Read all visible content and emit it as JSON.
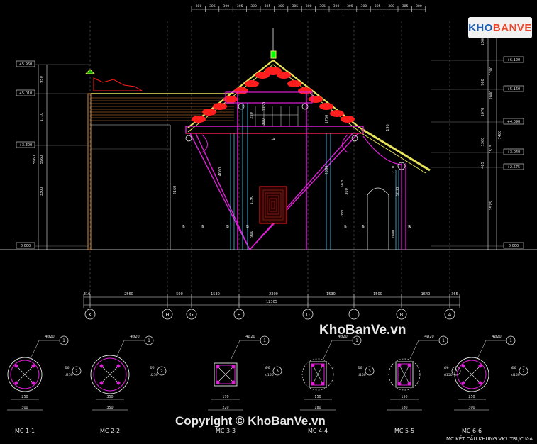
{
  "top_dims": [
    "300",
    "305",
    "300",
    "305",
    "300",
    "305",
    "300",
    "305",
    "300",
    "305",
    "300",
    "305",
    "300",
    "305",
    "300",
    "305",
    "300"
  ],
  "levels_left": [
    "+5.960",
    "+5.010",
    "+3.300",
    "0.000"
  ],
  "levels_right": [
    "+6.120",
    "+5.160",
    "+4.090",
    "+3.040",
    "+2.575",
    "0.000"
  ],
  "right_dims": [
    "1000",
    "1280",
    "960",
    "2080",
    "1070",
    "1360",
    "7400",
    "1515",
    "465",
    "2575"
  ],
  "left_dims": [
    "1710",
    "950",
    "3300",
    "5960",
    "5960"
  ],
  "bottom_dims": [
    "310",
    "2560",
    "500",
    "1530",
    "2300",
    "1530",
    "1500",
    "1640",
    "365"
  ],
  "total_dim": "12305",
  "grid_axes": [
    "K",
    "H",
    "G",
    "E",
    "D",
    "C",
    "B",
    "A"
  ],
  "inner_dims": [
    "250",
    "300",
    "1750",
    "2160",
    "4060",
    "1190",
    "900",
    "2080",
    "2880",
    "1750",
    "300",
    "5820",
    "195",
    "2110",
    "5030",
    "2880"
  ],
  "column_marks": [
    "1",
    "1",
    "2",
    "2",
    "1",
    "1",
    "3"
  ],
  "sections": [
    {
      "label": "MC 1-1",
      "bars": "4Ø20",
      "stirrup": "Ø6",
      "dia": "d250",
      "dim": "250",
      "width": "300",
      "callout": "1",
      "side": "2"
    },
    {
      "label": "MC 2-2",
      "bars": "4Ø20",
      "stirrup": "Ø6",
      "dia": "d250",
      "dim": "350",
      "width": "350",
      "callout": "1",
      "side": "2"
    },
    {
      "label": "MC 3-3",
      "bars": "4Ø20",
      "stirrup": "Ø6",
      "dia": "d150",
      "dim": "170",
      "width": "220",
      "callout": "1",
      "side": "3"
    },
    {
      "label": "MC 4-4",
      "bars": "4Ø20",
      "stirrup": "Ø6",
      "dia": "d150",
      "dim": "150",
      "width": "180",
      "callout": "1",
      "side": "3"
    },
    {
      "label": "MC 5-5",
      "bars": "4Ø20",
      "stirrup": "Ø6",
      "dia": "d150",
      "dim": "150",
      "width": "180",
      "callout": "1",
      "side": "3"
    },
    {
      "label": "MC 6-6",
      "bars": "4Ø20",
      "stirrup": "Ø6",
      "dia": "d150",
      "dim": "250",
      "width": "300",
      "callout": "1",
      "side": "2"
    }
  ],
  "drawing_title": "MC KẾT CẤU KHUNG VK1 TRỤC K-A",
  "watermark_main": "KhoBanVe.vn",
  "watermark_copyright": "Copyright © KhoBanVe.vn",
  "logo_left": "KHO",
  "logo_right": "BANVE"
}
